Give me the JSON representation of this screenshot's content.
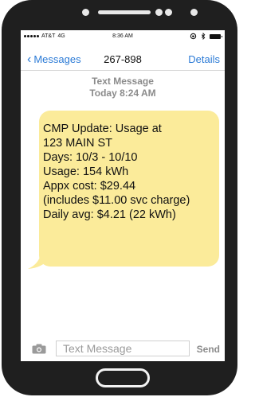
{
  "status_bar": {
    "carrier": "AT&T",
    "network": "4G",
    "time": "8:36 AM"
  },
  "nav": {
    "back_label": "Messages",
    "contact": "267-898",
    "details_label": "Details"
  },
  "conversation": {
    "type_label": "Text Message",
    "timestamp": "Today 8:24 AM",
    "message_lines": [
      "CMP Update: Usage at",
      "123 MAIN ST",
      "Days: 10/3 - 10/10",
      "Usage: 154 kWh",
      "Appx cost: $29.44",
      "(includes $11.00 svc charge)",
      "Daily avg: $4.21 (22 kWh)"
    ]
  },
  "composer": {
    "placeholder": "Text Message",
    "send_label": "Send"
  },
  "colors": {
    "accent": "#2c7bd6",
    "bubble": "#fbeb9a",
    "phone_body": "#1f1f1f"
  }
}
